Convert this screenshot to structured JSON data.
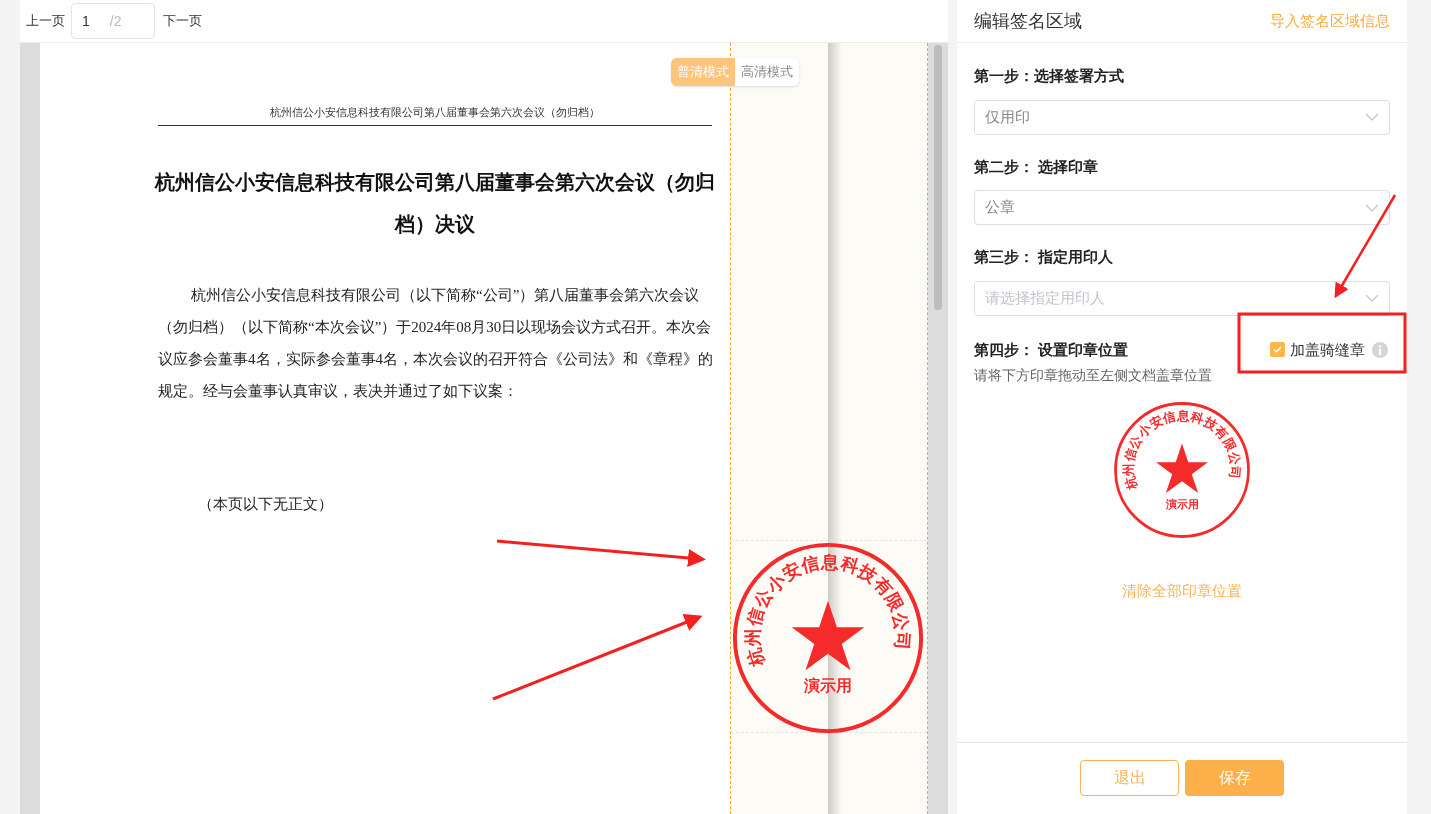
{
  "pager": {
    "prev": "上一页",
    "page": "1",
    "total": "/2",
    "next": "下一页"
  },
  "modes": [
    {
      "label": "普清模式",
      "selected": true
    },
    {
      "label": "高清模式",
      "selected": false
    }
  ],
  "document": {
    "header": "杭州信公小安信息科技有限公司第八届董事会第六次会议（勿归档）",
    "title": "杭州信公小安信息科技有限公司第八届董事会第六次会议（勿归档）决议",
    "body": "杭州信公小安信息科技有限公司（以下简称“公司”）第八届董事会第六次会议（勿归档）（以下简称“本次会议”）于2024年08月30日以现场会议方式召开。本次会议应参会董事4名，实际参会董事4名，本次会议的召开符合《公司法》和《章程》的规定。经与会董事认真审议，表决并通过了如下议案：",
    "note": "（本页以下无正文）"
  },
  "doc_stamp": {
    "company": "杭州信公小安信息科技有限公司",
    "note": "演示用"
  },
  "panel": {
    "title": "编辑签名区域",
    "import_link": "导入签名区域信息",
    "steps": [
      {
        "label": "第一步：选择签署方式",
        "value": "仅用印"
      },
      {
        "label": "第二步： 选择印章",
        "value": "公章"
      },
      {
        "label": "第三步： 指定用印人",
        "placeholder": "请选择指定用印人"
      }
    ],
    "position_step": {
      "label": "第四步： 设置印章位置",
      "seam_label": "加盖骑缝章",
      "seam_checked": true,
      "hint": "请将下方印章拖动至左侧文档盖章位置"
    },
    "stamp": {
      "company": "杭州信公小安信息科技有限公司",
      "note": "演示用"
    },
    "clear_link": "清除全部印章位置",
    "buttons": [
      {
        "label": "退出",
        "kind": "secondary"
      },
      {
        "label": "保存",
        "kind": "primary"
      }
    ]
  }
}
